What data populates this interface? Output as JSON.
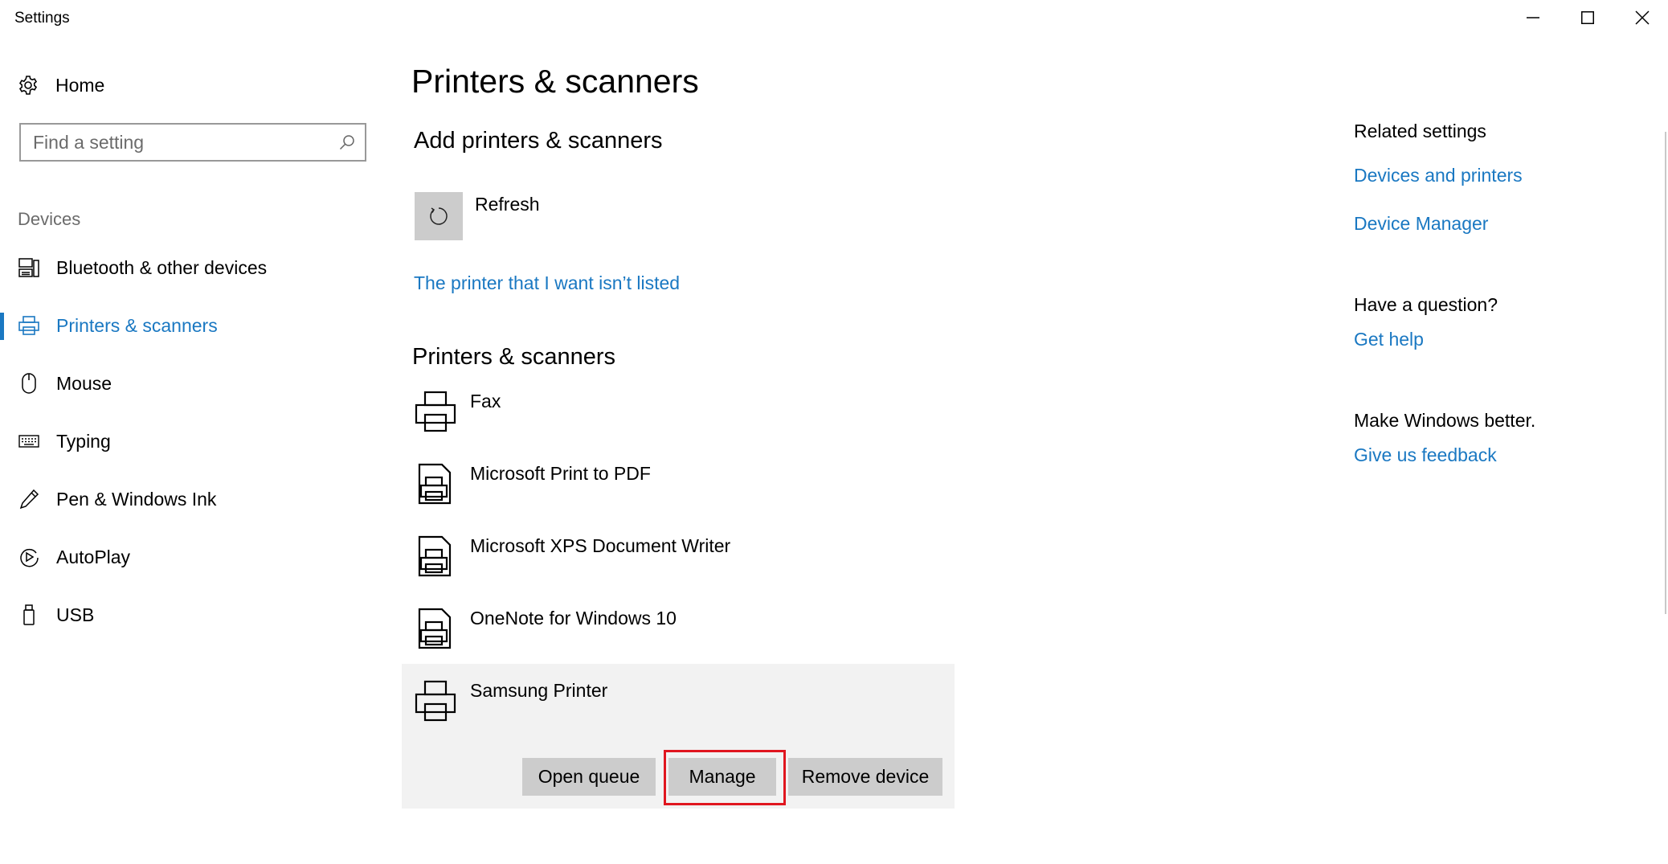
{
  "window": {
    "title": "Settings",
    "controls": [
      "minimize",
      "maximize",
      "close"
    ]
  },
  "nav": {
    "home_label": "Home",
    "search_placeholder": "Find a setting",
    "group_label": "Devices",
    "items": [
      {
        "label": "Bluetooth & other devices",
        "icon": "bluetooth-devices-icon",
        "active": false
      },
      {
        "label": "Printers & scanners",
        "icon": "printer-icon",
        "active": true
      },
      {
        "label": "Mouse",
        "icon": "mouse-icon",
        "active": false
      },
      {
        "label": "Typing",
        "icon": "keyboard-icon",
        "active": false
      },
      {
        "label": "Pen & Windows Ink",
        "icon": "pen-icon",
        "active": false
      },
      {
        "label": "AutoPlay",
        "icon": "autoplay-icon",
        "active": false
      },
      {
        "label": "USB",
        "icon": "usb-icon",
        "active": false
      }
    ]
  },
  "main": {
    "title": "Printers & scanners",
    "add_heading": "Add printers & scanners",
    "refresh_label": "Refresh",
    "not_listed_link": "The printer that I want isn’t listed",
    "list_heading": "Printers & scanners",
    "devices": [
      {
        "name": "Fax",
        "icon": "printer-icon"
      },
      {
        "name": "Microsoft Print to PDF",
        "icon": "document-printer-icon"
      },
      {
        "name": "Microsoft XPS Document Writer",
        "icon": "document-printer-icon"
      },
      {
        "name": "OneNote for Windows 10",
        "icon": "document-printer-icon"
      },
      {
        "name": "Samsung Printer",
        "icon": "printer-icon",
        "selected": true
      }
    ],
    "actions": {
      "open_queue": "Open queue",
      "manage": "Manage",
      "remove_device": "Remove device"
    }
  },
  "related": {
    "title": "Related settings",
    "links": [
      "Devices and printers",
      "Device Manager"
    ],
    "question_title": "Have a question?",
    "help_link": "Get help",
    "better_title": "Make Windows better.",
    "feedback_link": "Give us feedback"
  },
  "colors": {
    "accent": "#1a78c2",
    "highlight": "#e0161f",
    "selected_bg": "#f2f2f2",
    "button_bg": "#cccccc"
  }
}
